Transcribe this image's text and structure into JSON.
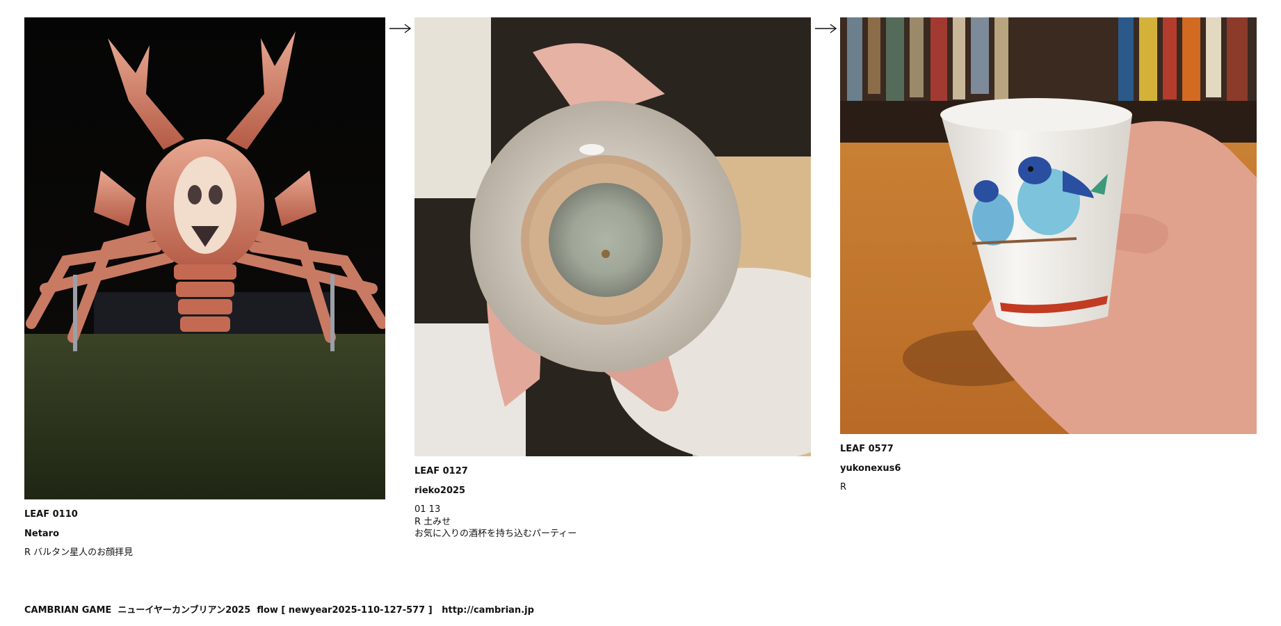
{
  "leaves": [
    {
      "id": "LEAF 0110",
      "author": "Netaro",
      "comment": "R バルタン星人のお顔拝見",
      "photo": "giant-lobster-statue-night"
    },
    {
      "id": "LEAF 0127",
      "author": "rieko2025",
      "date": "01 13",
      "comment": "R 土みせ",
      "note": "お気に入りの酒杯を持ち込むパーティー",
      "photo": "ceramic-cup-bottom-in-hand"
    },
    {
      "id": "LEAF 0577",
      "author": "yukonexus6",
      "comment": "R",
      "photo": "sake-cup-with-bird-painting"
    }
  ],
  "arrows": [
    "arrow-right-icon",
    "arrow-right-icon"
  ],
  "footer": {
    "game": "CAMBRIAN GAME",
    "event": "ニューイヤーカンブリアン2025",
    "flow": "flow [ newyear2025-110-127-577 ]",
    "url": "http://cambrian.jp"
  }
}
